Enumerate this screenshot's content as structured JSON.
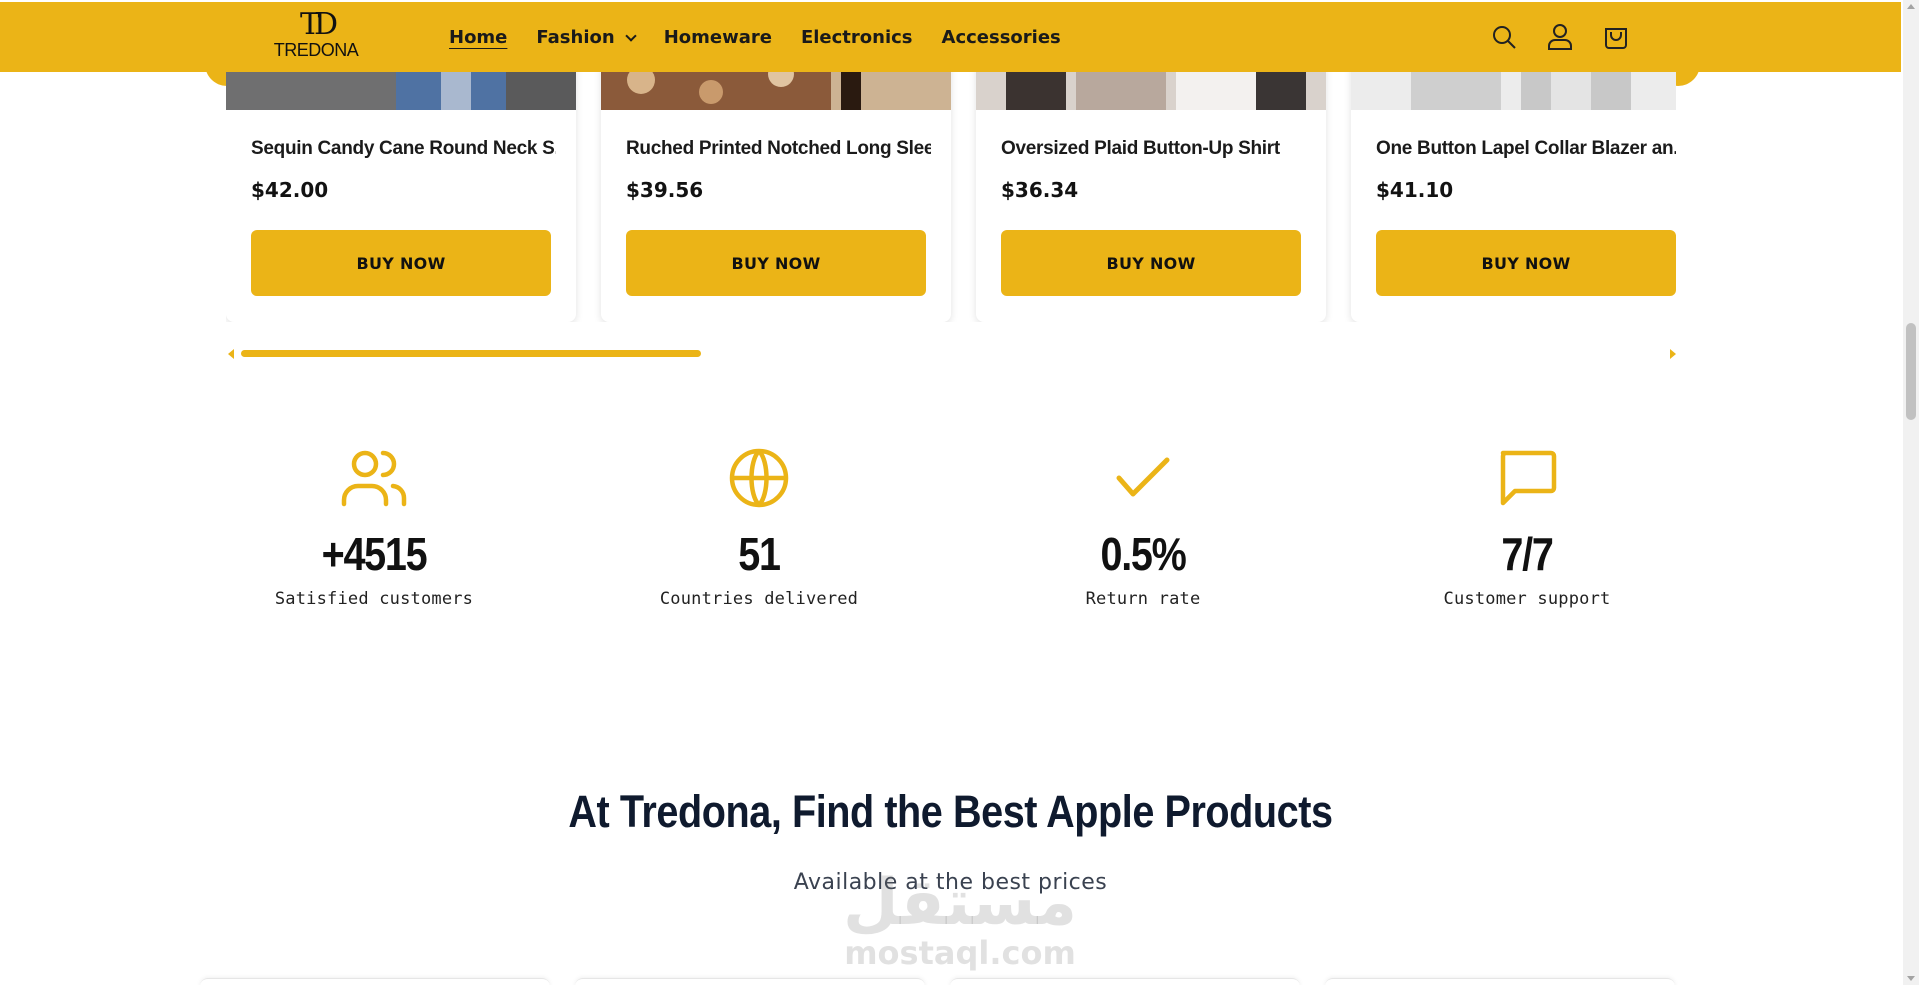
{
  "header": {
    "logo_mark": "TD",
    "logo_text": "TREDONA",
    "nav": [
      "Home",
      "Fashion",
      "Homeware",
      "Electronics",
      "Accessories"
    ],
    "icons": [
      "search-icon",
      "account-icon",
      "cart-icon"
    ]
  },
  "products": [
    {
      "title": "Sequin Candy Cane Round Neck S...",
      "price": "$42.00",
      "button": "BUY NOW"
    },
    {
      "title": "Ruched Printed Notched Long Slee...",
      "price": "$39.56",
      "button": "BUY NOW"
    },
    {
      "title": "Oversized Plaid Button-Up Shirt",
      "price": "$36.34",
      "button": "BUY NOW"
    },
    {
      "title": "One Button Lapel Collar Blazer an...",
      "price": "$41.10",
      "button": "BUY NOW"
    }
  ],
  "stats": [
    {
      "icon": "users-icon",
      "value": "+4515",
      "label": "Satisfied customers"
    },
    {
      "icon": "globe-icon",
      "value": "51",
      "label": "Countries delivered"
    },
    {
      "icon": "checkmark-icon",
      "value": "0.5%",
      "label": "Return rate"
    },
    {
      "icon": "chat-icon",
      "value": "7/7",
      "label": "Customer support"
    }
  ],
  "section": {
    "title": "At Tredona, Find the Best Apple Products",
    "subtitle": "Available at the best prices"
  },
  "watermark": {
    "arabic": "مستقل",
    "latin": "mostaql.com"
  },
  "colors": {
    "accent": "#ebb417",
    "heading": "#0f1a2e"
  }
}
